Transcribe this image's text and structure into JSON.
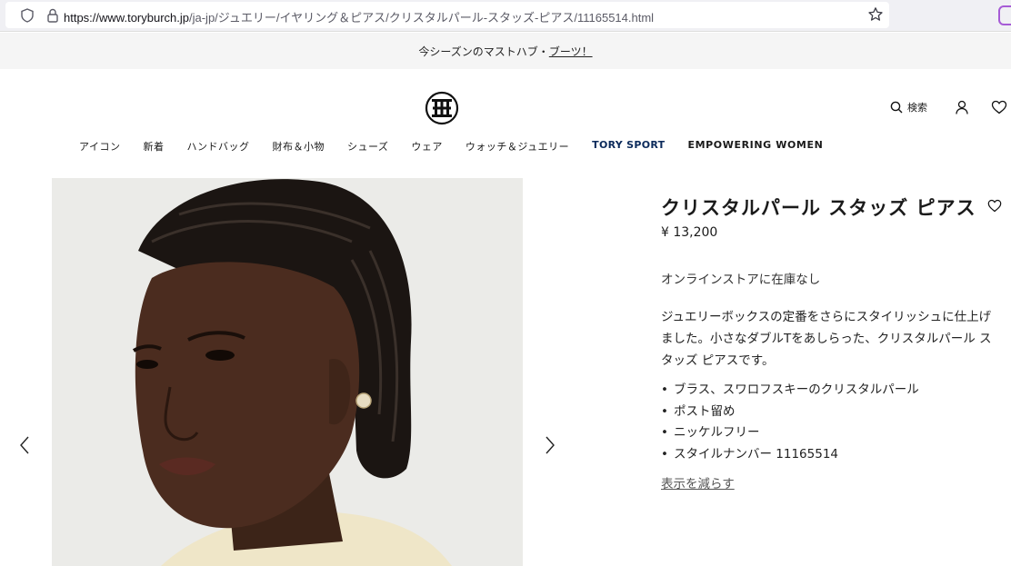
{
  "browser": {
    "url_host": "https://www.toryburch.jp",
    "url_path": "/ja-jp/ジュエリー/イヤリング＆ピアス/クリスタルパール-スタッズ-ピアス/11165514.html"
  },
  "promo": {
    "text": "今シーズンのマストハブ・",
    "link": "ブーツ！"
  },
  "header": {
    "search_label": "検索",
    "icons": [
      "search-icon",
      "account-icon",
      "heart-icon",
      "logo-icon"
    ]
  },
  "nav": {
    "items": [
      "アイコン",
      "新着",
      "ハンドバッグ",
      "財布＆小物",
      "シューズ",
      "ウェア",
      "ウォッチ＆ジュエリー",
      "TORY SPORT",
      "EMPOWERING WOMEN"
    ]
  },
  "gallery": {
    "icons": [
      "chevron-left-icon",
      "chevron-right-icon"
    ]
  },
  "product": {
    "title": "クリスタルパール スタッズ ピアス",
    "price": "¥ 13,200",
    "stock": "オンラインストアに在庫なし",
    "description": "ジュエリーボックスの定番をさらにスタイリッシュに仕上げました。小さなダブルTをあしらった、クリスタルパール スタッズ ピアスです。",
    "bullets": [
      "ブラス、スワロフスキーのクリスタルパール",
      "ポスト留め",
      "ニッケルフリー",
      "スタイルナンバー 11165514"
    ],
    "show_less": "表示を減らす"
  },
  "colors": {
    "sport_blue": "#0b2a5b",
    "promo_bg": "#f5f5f5"
  }
}
